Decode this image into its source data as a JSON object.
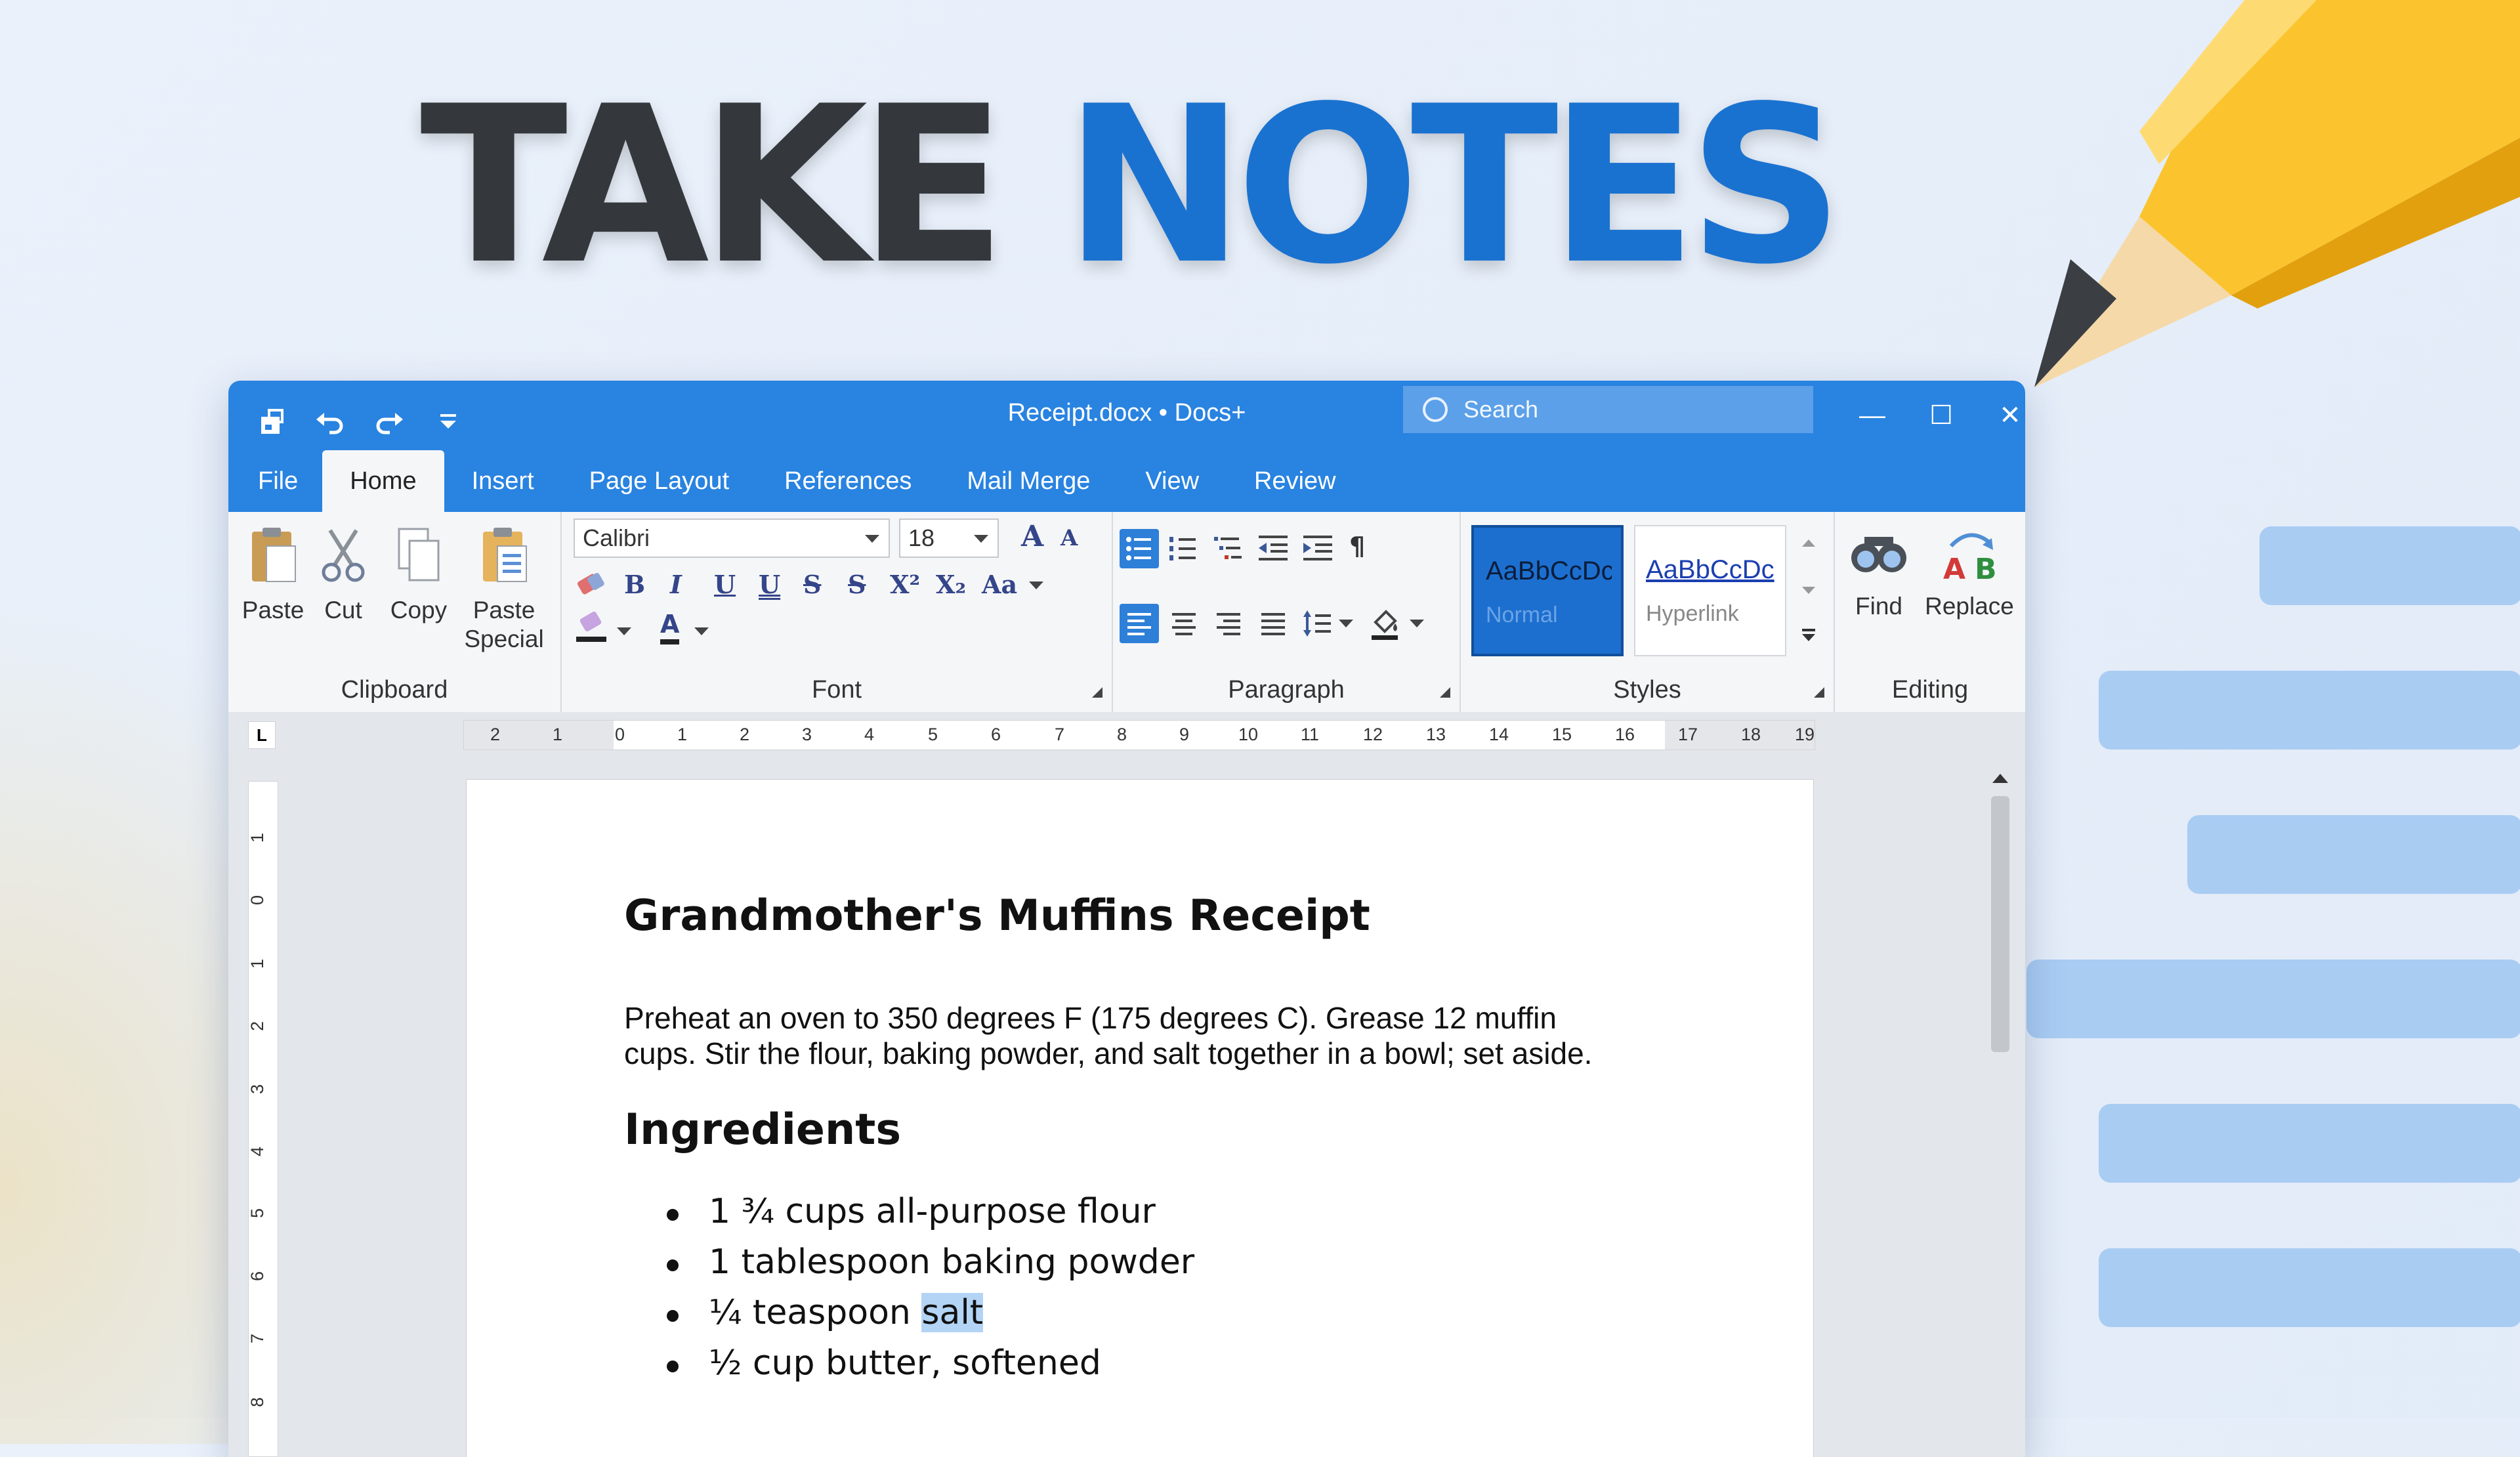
{
  "headline": {
    "word1": "TAKE",
    "word2": "NOTES"
  },
  "window": {
    "title": "Receipt.docx • Docs+",
    "search_placeholder": "Search",
    "quick_access": [
      "save-icon",
      "undo-icon",
      "redo-icon",
      "customize-icon"
    ],
    "controls": {
      "minimize": "—",
      "maximize": "☐",
      "close": "✕"
    }
  },
  "tabs": [
    "File",
    "Home",
    "Insert",
    "Page Layout",
    "References",
    "Mail Merge",
    "View",
    "Review"
  ],
  "active_tab": "Home",
  "ribbon": {
    "clipboard": {
      "label": "Clipboard",
      "paste": "Paste",
      "cut": "Cut",
      "copy": "Copy",
      "paste_special_1": "Paste",
      "paste_special_2": "Special"
    },
    "font": {
      "label": "Font",
      "family": "Calibri",
      "size": "18",
      "grow": "A",
      "shrink": "A",
      "b": "B",
      "i": "I",
      "u": "U",
      "uu": "U",
      "s": "S",
      "ss": "S",
      "sup": "X²",
      "sub": "X₂",
      "case": "Aa",
      "color": "A"
    },
    "paragraph": {
      "label": "Paragraph",
      "pilcrow": "¶"
    },
    "styles": {
      "label": "Styles",
      "normal_sample": "AaBbCcDc",
      "normal_name": "Normal",
      "hyperlink_sample": "AaBbCcDc",
      "hyperlink_name": "Hyperlink"
    },
    "editing": {
      "label": "Editing",
      "find": "Find",
      "replace": "Replace"
    }
  },
  "ruler": {
    "horizontal": [
      "2",
      "1",
      "0",
      "1",
      "2",
      "3",
      "4",
      "5",
      "6",
      "7",
      "8",
      "9",
      "10",
      "11",
      "12",
      "13",
      "14",
      "15",
      "16",
      "17",
      "18",
      "19"
    ],
    "vertical": [
      "1",
      "0",
      "1",
      "2",
      "3",
      "4",
      "5",
      "6",
      "7",
      "8"
    ],
    "corner": "L"
  },
  "document": {
    "title": "Grandmother's Muffins Receipt",
    "intro_line1": "Preheat an oven to 350 degrees F (175 degrees C). Grease 12 muffin",
    "intro_line2": "cups. Stir the flour, baking powder, and salt together in a bowl; set aside.",
    "ingredients_heading": "Ingredients",
    "ingredients": [
      {
        "text": "1 ¾ cups all-purpose flour"
      },
      {
        "text": "1 tablespoon baking powder"
      },
      {
        "pre": "¼ teaspoon ",
        "selected": "salt"
      },
      {
        "text": "½ cup butter, softened"
      }
    ]
  },
  "colors": {
    "accent": "#2983e0",
    "headline_dark": "#34383c",
    "headline_blue": "#1a72d0",
    "selection": "#b3d4f5"
  }
}
